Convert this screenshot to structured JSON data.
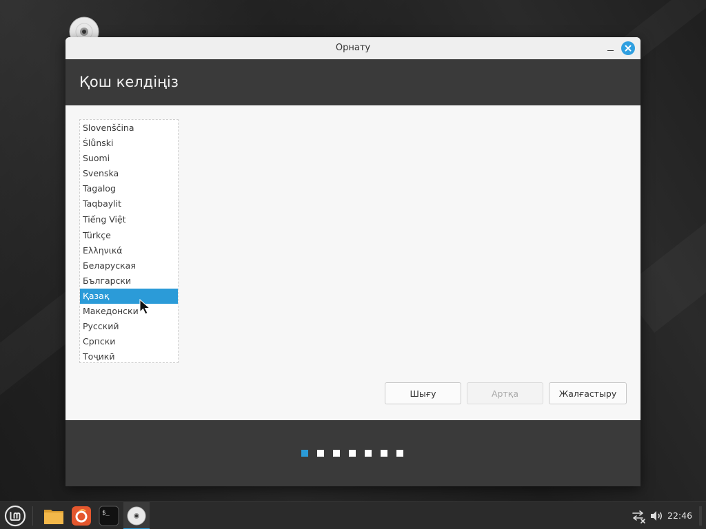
{
  "window": {
    "title": "Орнату",
    "heading": "Қош келдіңіз"
  },
  "languages": {
    "items": [
      "Slovenščina",
      "Ślůnski",
      "Suomi",
      "Svenska",
      "Tagalog",
      "Taqbaylit",
      "Tiếng Việt",
      "Türkçe",
      "Ελληνικά",
      "Беларуская",
      "Български",
      "Қазақ",
      "Македонски",
      "Русский",
      "Српски",
      "Тоҷикӣ"
    ],
    "selected": "Қазақ"
  },
  "buttons": {
    "quit_label": "Шығу",
    "back_label": "Артқа",
    "continue_label": "Жалғастыру"
  },
  "progress": {
    "total_steps": 7,
    "current_step": 1
  },
  "taskbar": {
    "clock": "22:46",
    "apps": [
      "mint-menu-icon",
      "files-icon",
      "firefox-icon",
      "terminal-icon",
      "installer-disc-icon"
    ]
  },
  "colors": {
    "accent": "#2b9bd8",
    "header_bg": "#3a3a3a",
    "selection_text": "#ffffff"
  }
}
